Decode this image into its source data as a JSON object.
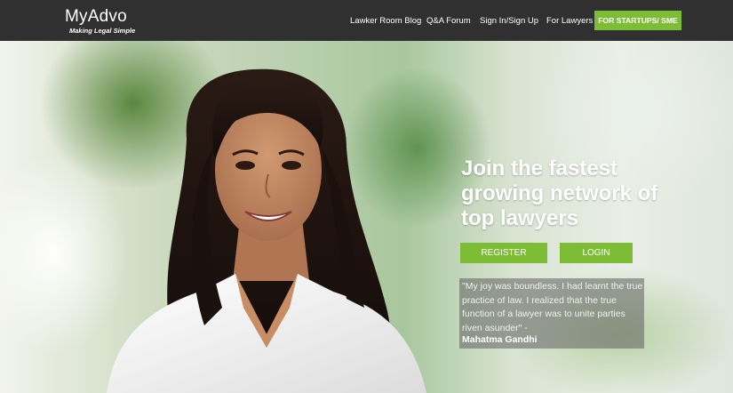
{
  "header": {
    "logo_text": "MyAdvo",
    "logo_tagline": "Making Legal Simple",
    "nav": [
      {
        "label": "Lawker Room Blog"
      },
      {
        "label": "Q&A Forum"
      },
      {
        "label": "Sign In/Sign Up"
      },
      {
        "label": "For Lawyers"
      }
    ],
    "cta_label": "FOR STARTUPS/ SME"
  },
  "hero": {
    "headline": "Join the fastest growing network of top lawyers",
    "register_label": "REGISTER",
    "login_label": "LOGIN",
    "quote": "\"My joy was boundless. I had learnt the true practice of law. I realized that the true function of a lawyer was to unite parties riven asunder\" -",
    "quote_author": "Mahatma Gandhi"
  },
  "colors": {
    "header_bg": "#303030",
    "accent_green": "#7cbd35",
    "text_white": "#ffffff"
  }
}
